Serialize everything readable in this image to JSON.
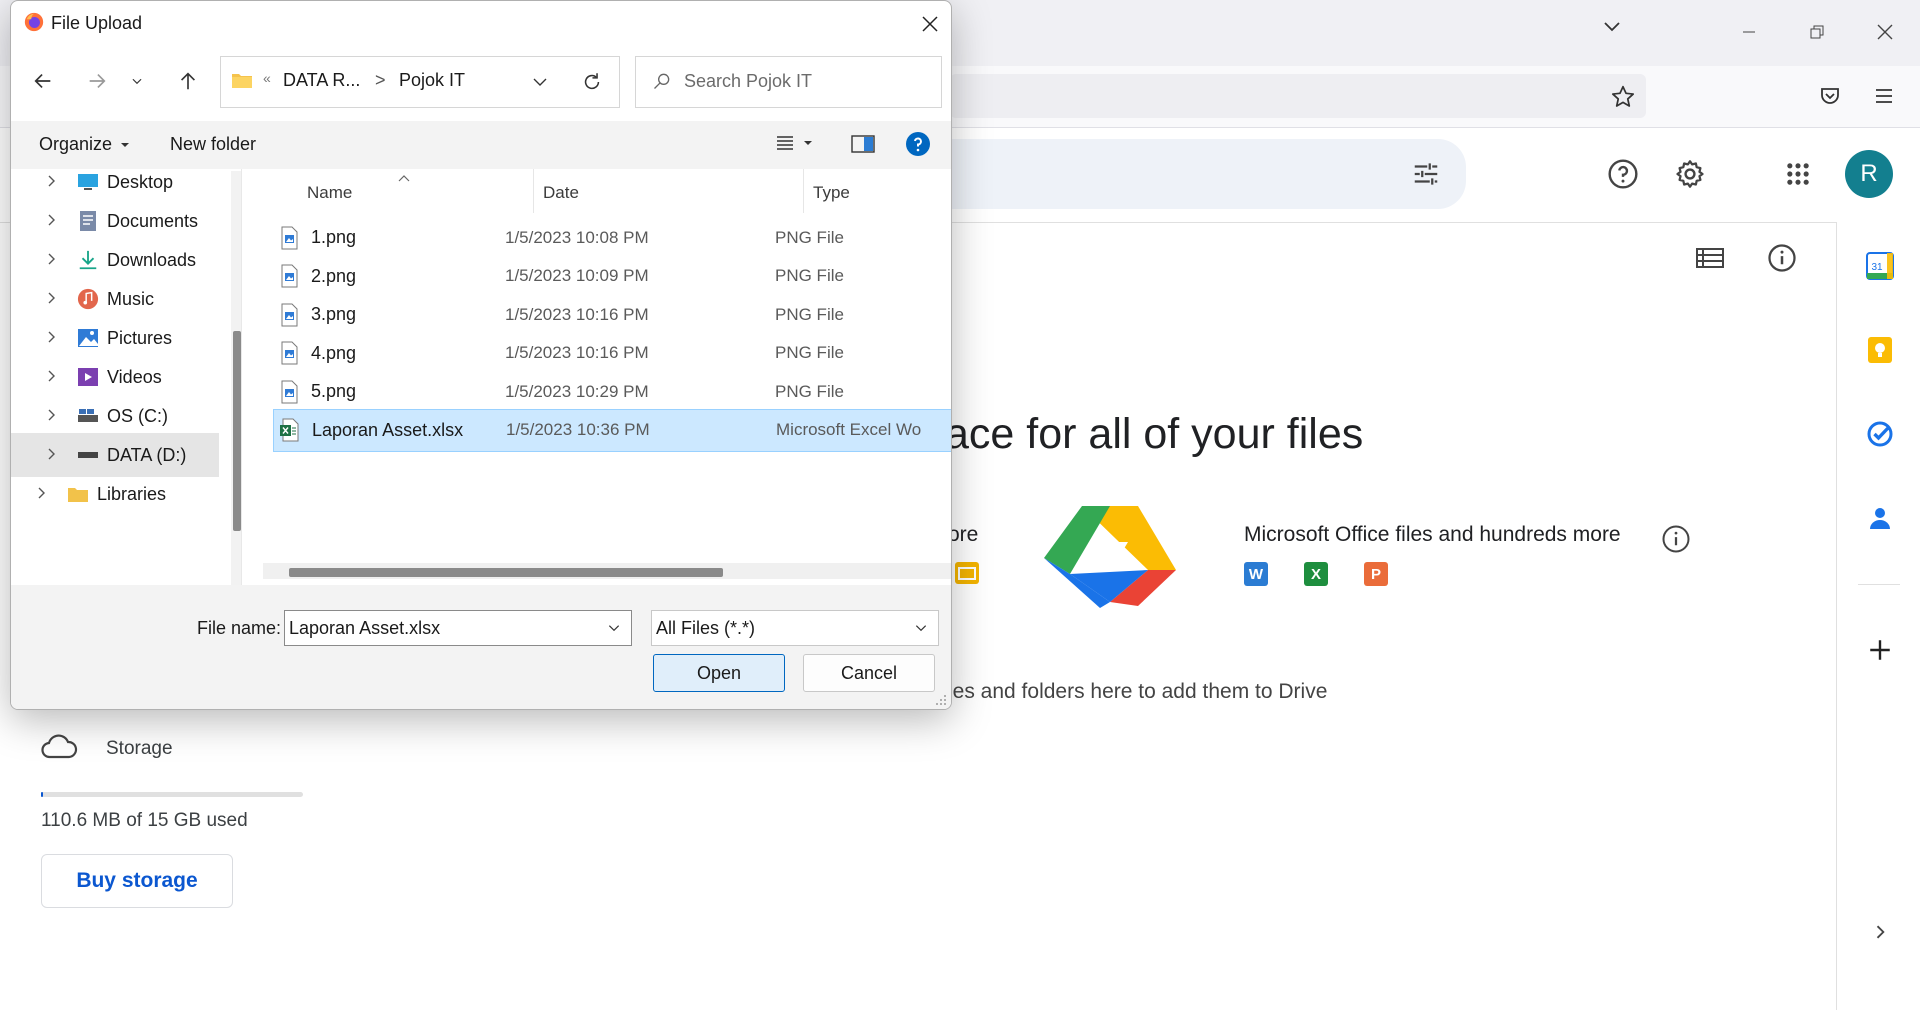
{
  "browser": {
    "window_controls": [
      "minimize",
      "restore",
      "close"
    ]
  },
  "drive": {
    "welcome_fragment": "ace for all of your files",
    "more_fragment": "ore",
    "ms_office_text": "Microsoft Office files and hundreds more",
    "drop_hint_fragment": "les and folders here to add them to Drive",
    "storage": {
      "label": "Storage",
      "used_text": "110.6 MB of 15 GB used",
      "used_fraction": 0.007,
      "buy_label": "Buy storage"
    },
    "avatar_letter": "R",
    "office_badges": [
      {
        "letter": "W",
        "color": "#2b7cd3"
      },
      {
        "letter": "X",
        "color": "#1e8e3e"
      },
      {
        "letter": "P",
        "color": "#ea6c3a"
      }
    ]
  },
  "dialog": {
    "title": "File Upload",
    "breadcrumb": {
      "overflow": "«",
      "parent": "DATA R...",
      "separator": ">",
      "current": "Pojok IT"
    },
    "search_placeholder": "Search Pojok IT",
    "commands": {
      "organize": "Organize",
      "new_folder": "New folder"
    },
    "nav_items": [
      {
        "label": "Desktop",
        "icon": "desktop-icon",
        "color": "#2aa3e0"
      },
      {
        "label": "Documents",
        "icon": "documents-icon",
        "color": "#7a8aa8"
      },
      {
        "label": "Downloads",
        "icon": "downloads-icon",
        "color": "#17a589"
      },
      {
        "label": "Music",
        "icon": "music-icon",
        "color": "#e2664c"
      },
      {
        "label": "Pictures",
        "icon": "pictures-icon",
        "color": "#2f7bd6"
      },
      {
        "label": "Videos",
        "icon": "videos-icon",
        "color": "#7b3fb0"
      },
      {
        "label": "OS (C:)",
        "icon": "drive-c-icon",
        "color": "#3a6fb5"
      },
      {
        "label": "DATA (D:)",
        "icon": "drive-d-icon",
        "color": "#444444"
      },
      {
        "label": "Libraries",
        "icon": "libraries-icon",
        "color": "#f2c24a"
      }
    ],
    "columns": {
      "name": "Name",
      "date": "Date",
      "type": "Type"
    },
    "files": [
      {
        "name": "1.png",
        "date": "1/5/2023 10:08 PM",
        "type": "PNG File",
        "kind": "png"
      },
      {
        "name": "2.png",
        "date": "1/5/2023 10:09 PM",
        "type": "PNG File",
        "kind": "png"
      },
      {
        "name": "3.png",
        "date": "1/5/2023 10:16 PM",
        "type": "PNG File",
        "kind": "png"
      },
      {
        "name": "4.png",
        "date": "1/5/2023 10:16 PM",
        "type": "PNG File",
        "kind": "png"
      },
      {
        "name": "5.png",
        "date": "1/5/2023 10:29 PM",
        "type": "PNG File",
        "kind": "png"
      },
      {
        "name": "Laporan Asset.xlsx",
        "date": "1/5/2023 10:36 PM",
        "type": "Microsoft Excel Wo",
        "kind": "xlsx"
      }
    ],
    "selected_file_index": 5,
    "file_name_label": "File name:",
    "file_name_value": "Laporan Asset.xlsx",
    "file_type_value": "All Files (*.*)",
    "open_label": "Open",
    "cancel_label": "Cancel"
  }
}
